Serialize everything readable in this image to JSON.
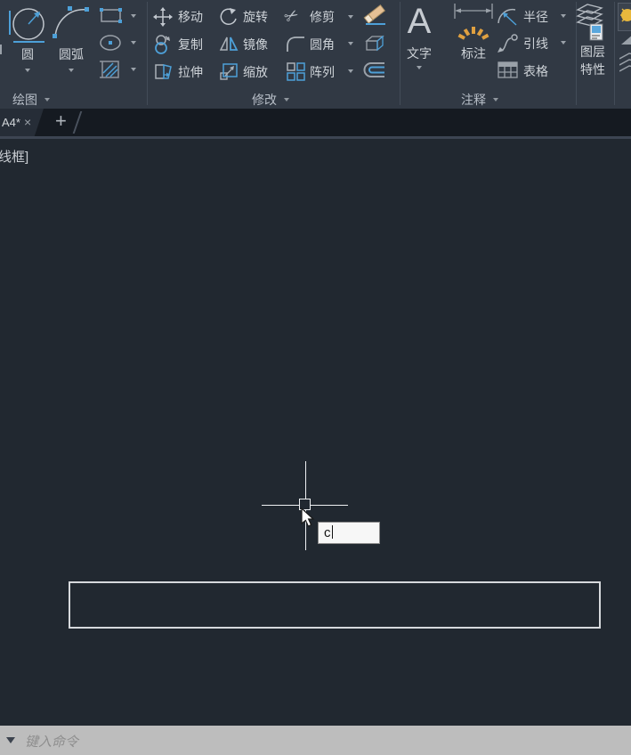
{
  "ribbon": {
    "draw": {
      "panel_label": "绘图",
      "circle": "圆",
      "arc": "圆弧"
    },
    "modify": {
      "panel_label": "修改",
      "move": "移动",
      "rotate": "旋转",
      "trim": "修剪",
      "copy": "复制",
      "mirror": "镜像",
      "fillet": "圆角",
      "stretch": "拉伸",
      "scale": "缩放",
      "array": "阵列"
    },
    "annotate": {
      "panel_label": "注释",
      "text": "文字",
      "text_icon_letter": "A",
      "dimension": "标注",
      "radius": "半径",
      "leader": "引线",
      "table": "表格"
    },
    "layers": {
      "props_line1": "图层",
      "props_line2": "特性"
    }
  },
  "tab_bar": {
    "active_tab": "A4*",
    "close": "×",
    "new_tab": "+"
  },
  "canvas": {
    "viewport_label": "线框]",
    "text_input_value": "c"
  },
  "command_bar": {
    "prompt": "键入命令"
  },
  "colors": {
    "accent_blue": "#4da0d8",
    "icon_gray": "#aab1b8",
    "ribbon_bg": "#313944",
    "canvas_bg": "#212830",
    "command_bar_bg": "#bdbdbd",
    "eraser_tan": "#e5c095",
    "dimension_orange": "#dfa040",
    "bulb_yellow": "#e8b83d"
  }
}
